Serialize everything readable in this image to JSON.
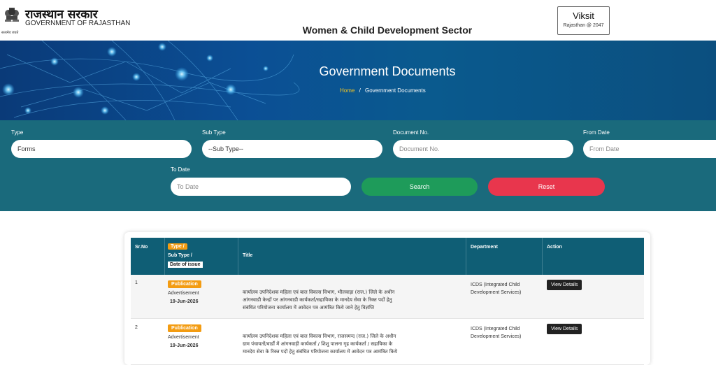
{
  "header": {
    "emblem_caption": "सत्यमेव जयते",
    "gov_hindi": "राजस्थान सरकार",
    "gov_english": "GOVERNMENT OF RAJASTHAN",
    "sector": "Women & Child Development Sector",
    "viksit_title": "Viksit",
    "viksit_sub": "Rajasthan @ 2047"
  },
  "banner": {
    "title": "Government Documents",
    "breadcrumb_home": "Home",
    "breadcrumb_sep": "/",
    "breadcrumb_current": "Government Documents"
  },
  "filters": {
    "type_label": "Type",
    "type_value": "Forms",
    "subtype_label": "Sub Type",
    "subtype_value": "--Sub Type--",
    "docno_label": "Document No.",
    "docno_placeholder": "Document No.",
    "fromdate_label": "From Date",
    "fromdate_placeholder": "From Date",
    "todate_label": "To Date",
    "todate_placeholder": "To Date",
    "search_label": "Search",
    "reset_label": "Reset"
  },
  "table": {
    "headers": {
      "srno": "Sr.No",
      "type": "Type /",
      "subtype": "Sub Type /",
      "date": "Date of issue",
      "title": "Title",
      "department": "Department",
      "action": "Action"
    },
    "rows": [
      {
        "srno": "1",
        "type": "Publication",
        "subtype": "Advertisement",
        "date": "19-Jun-2026",
        "title_line1": "कार्यालय उपनिदेशक महिला एवं बाल विकास विभाग, भीलवाड़ा (राज.) जिले के अधीन",
        "title_line2": "आंगनवाडी केन्द्रों पर आंगनवाडी कार्यकर्ता/सहायिका के मानदेय सेवा के रिक्त पदों हेतु",
        "title_line3": "संबंधित परियोजना कार्यालय में आवेदन पत्र आमंत्रित किये जाने हेतु विज्ञप्ति",
        "department_line1": "ICDS (Integrated Child",
        "department_line2": "Development Services)",
        "action": "View Details"
      },
      {
        "srno": "2",
        "type": "Publication",
        "subtype": "Advertisement",
        "date": "19-Jun-2026",
        "title_line1": "कार्यालय उपनिदेशक महिला एवं बाल विकास विभाग, राजसमन्द (राज.) जिले के अधीन",
        "title_line2": "ग्राम पंचायतों/वार्डों में आंगनवाड़ी कार्यकर्ता / शिशु पालना गृह कार्यकर्ता / सहायिका के",
        "title_line3": "मानदेय सेवा के रिक्त पदों हेतु संबंधित परियोजना कार्यालय में आवेदन पत्र आमंत्रित किये",
        "department_line1": "ICDS (Integrated Child",
        "department_line2": "Development Services)",
        "action": "View Details"
      }
    ]
  },
  "colors": {
    "filter_bg": "#1a6a7c",
    "table_header": "#0f5e75",
    "accent_orange": "#f39c12",
    "search_green": "#1e9b5a",
    "reset_red": "#e8364d"
  }
}
